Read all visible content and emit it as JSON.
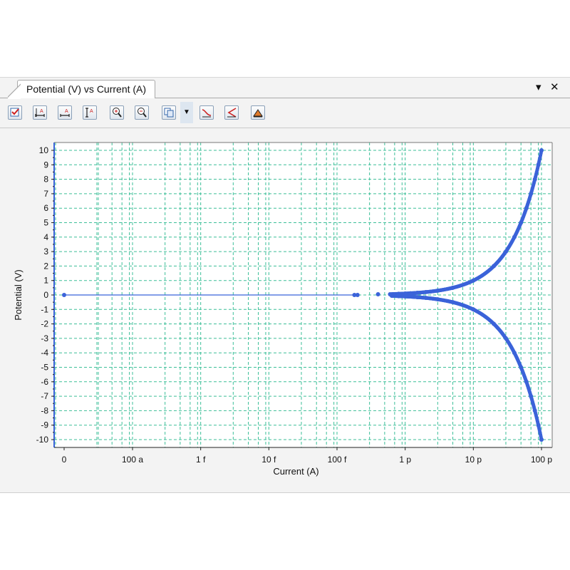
{
  "window": {
    "tab_title": "Potential (V) vs Current (A)",
    "menu_glyph": "▾",
    "close_glyph": "✕"
  },
  "toolbar": {
    "buttons": [
      {
        "icon": "properties-checklist-icon"
      },
      {
        "icon": "autoscale-x-axis-icon"
      },
      {
        "icon": "autoscale-x-axis-alt-icon"
      },
      {
        "icon": "autoscale-y-axis-icon"
      },
      {
        "icon": "zoom-in-icon"
      },
      {
        "icon": "zoom-out-icon"
      },
      {
        "icon": "copy-icon"
      },
      {
        "icon": "dropdown-arrow-icon"
      },
      {
        "icon": "linear-fit-icon"
      },
      {
        "icon": "tafel-fit-icon"
      },
      {
        "icon": "peak-find-icon"
      }
    ]
  },
  "colors": {
    "series": "#3b63d9",
    "grid": "#3cbf98",
    "axis": "#3b63d9",
    "plot_bg": "#ffffff"
  },
  "chart_data": {
    "type": "scatter",
    "title": "",
    "xlabel": "Current (A)",
    "ylabel": "Potential (V)",
    "x_scale": "log (decades)",
    "x_tick_labels": [
      "0",
      "100 a",
      "1 f",
      "10 f",
      "100 f",
      "1 p",
      "10 p",
      "100 p"
    ],
    "x_tick_values": [
      0,
      1e-16,
      1e-15,
      1e-14,
      1e-13,
      1e-12,
      1e-11,
      1e-10
    ],
    "y_tick_labels": [
      "10",
      "9",
      "8",
      "7",
      "6",
      "5",
      "4",
      "3",
      "2",
      "1",
      "0",
      "-1",
      "-2",
      "-3",
      "-4",
      "-5",
      "-6",
      "-7",
      "-8",
      "-9",
      "-10"
    ],
    "ylim": [
      -10,
      10
    ],
    "xlim": [
      0,
      1.1e-10
    ],
    "grid": true,
    "series": [
      {
        "name": "",
        "description_of_shape": "points symmetric about 0 V; |V| grows with current up to ±10 V at 100 pA",
        "points": [
          {
            "x": 0,
            "y": 0
          },
          {
            "x": 1.8e-13,
            "y": 0
          },
          {
            "x": 2e-13,
            "y": 0
          },
          {
            "x": 4e-13,
            "y": 0.05
          },
          {
            "x": 6e-13,
            "y": 0.05
          },
          {
            "x": 8e-13,
            "y": 0.08
          },
          {
            "x": 1e-12,
            "y": 0.1
          },
          {
            "x": 1.2e-12,
            "y": 0.12
          },
          {
            "x": 1.5e-12,
            "y": 0.15
          },
          {
            "x": 2e-12,
            "y": 0.2
          },
          {
            "x": 3e-12,
            "y": 0.3
          },
          {
            "x": 5e-12,
            "y": 0.5
          },
          {
            "x": 1e-11,
            "y": 1.0
          },
          {
            "x": 2e-11,
            "y": 2.0
          },
          {
            "x": 3e-11,
            "y": 3.0
          },
          {
            "x": 4e-11,
            "y": 4.0
          },
          {
            "x": 5e-11,
            "y": 5.0
          },
          {
            "x": 6e-11,
            "y": 6.0
          },
          {
            "x": 7e-11,
            "y": 7.0
          },
          {
            "x": 8e-11,
            "y": 8.0
          },
          {
            "x": 9e-11,
            "y": 9.0
          },
          {
            "x": 1e-10,
            "y": 10.0
          },
          {
            "x": 8e-13,
            "y": -0.08
          },
          {
            "x": 1e-12,
            "y": -0.1
          },
          {
            "x": 1.5e-12,
            "y": -0.15
          },
          {
            "x": 2e-12,
            "y": -0.2
          },
          {
            "x": 3e-12,
            "y": -0.3
          },
          {
            "x": 5e-12,
            "y": -0.5
          },
          {
            "x": 1e-11,
            "y": -1.0
          },
          {
            "x": 2e-11,
            "y": -2.0
          },
          {
            "x": 3e-11,
            "y": -3.0
          },
          {
            "x": 4e-11,
            "y": -4.0
          },
          {
            "x": 5e-11,
            "y": -5.0
          },
          {
            "x": 6e-11,
            "y": -6.0
          },
          {
            "x": 7e-11,
            "y": -7.0
          },
          {
            "x": 8e-11,
            "y": -8.0
          },
          {
            "x": 9e-11,
            "y": -9.0
          },
          {
            "x": 1e-10,
            "y": -10.0
          }
        ]
      }
    ]
  }
}
